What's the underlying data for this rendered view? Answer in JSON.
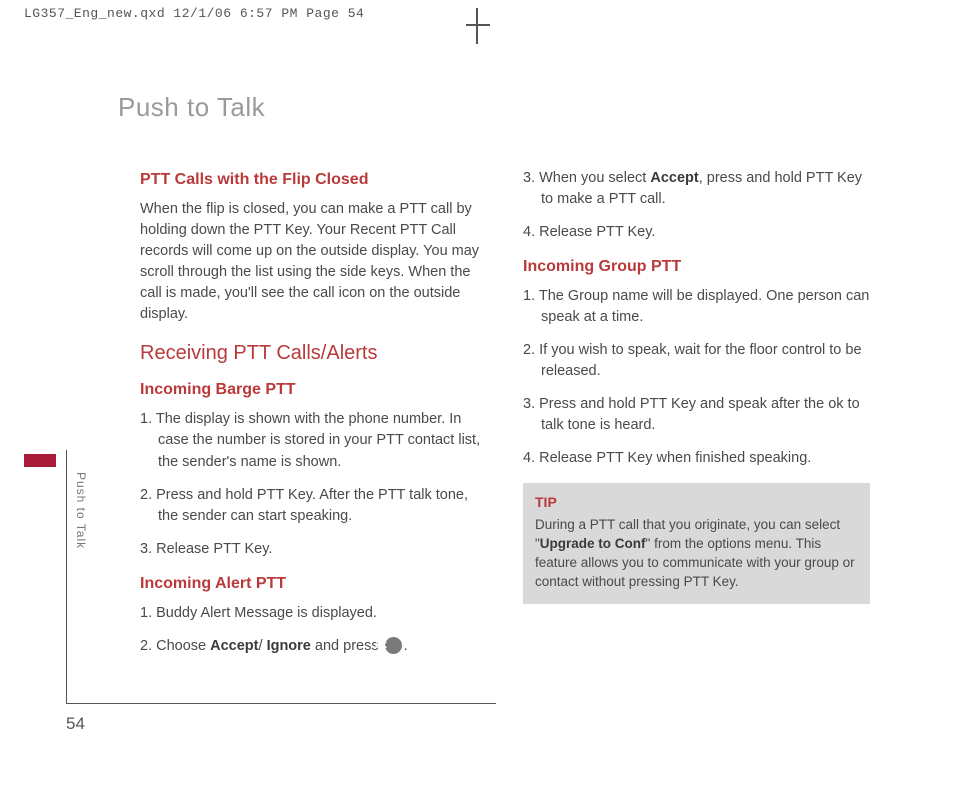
{
  "prepress": "LG357_Eng_new.qxd  12/1/06  6:57 PM  Page 54",
  "page_number": "54",
  "side_label": "Push to Talk",
  "chapter_title": "Push to Talk",
  "left": {
    "h1": "PTT Calls with the Flip Closed",
    "p1": "When the flip is closed, you can make a PTT call by holding down the PTT Key. Your Recent PTT Call records will come up on the outside display. You may scroll through the list using the side keys. When the call is made, you'll see the call icon on the outside display.",
    "h2": "Receiving PTT Calls/Alerts",
    "h3": "Incoming Barge PTT",
    "s1": "1. The display is shown with the phone number. In case the number is stored in your PTT contact list, the sender's name is shown.",
    "s2": "2. Press and hold PTT Key. After the PTT talk tone, the sender can start speaking.",
    "s3": "3. Release PTT Key.",
    "h4": "Incoming Alert PTT",
    "s4": "1. Buddy Alert Message is displayed.",
    "s5a": "2. Choose ",
    "s5b": "Accept",
    "s5c": "/ ",
    "s5d": "Ignore",
    "s5e": " and press ",
    "s5f": "."
  },
  "right": {
    "s1a": "3. When you select ",
    "s1b": "Accept",
    "s1c": ", press and hold PTT Key to make a PTT call.",
    "s2": "4. Release PTT Key.",
    "h1": "Incoming Group PTT",
    "s3": "1. The Group name will be displayed. One person can speak at a time.",
    "s4": "2. If you wish to speak, wait for the floor control to be released.",
    "s5": "3. Press and hold PTT Key and speak after the ok to talk tone is heard.",
    "s6": "4. Release PTT Key when finished speaking.",
    "tip_title": "TIP",
    "tip_a": "During a PTT call that you originate, you can select \"",
    "tip_b": "Upgrade to Conf",
    "tip_c": "\" from the options menu. This feature allows you to communicate with your group or contact without pressing  PTT Key."
  },
  "ok_label": "OK"
}
